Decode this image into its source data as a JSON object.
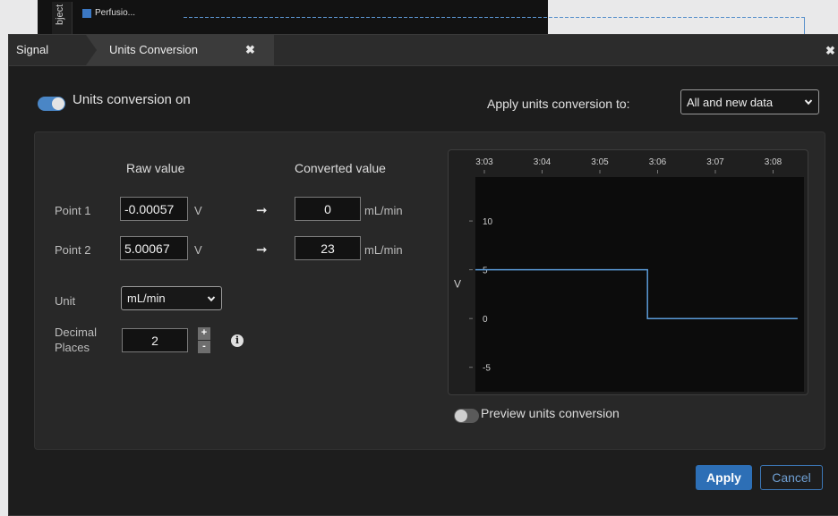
{
  "background": {
    "vertical_tab": "bject",
    "channel_name": "Perfusio...",
    "channel_color": "#3b78c4"
  },
  "tabs": {
    "signal": "Signal",
    "active": "Units Conversion",
    "close_glyph": "✖",
    "dialog_close_glyph": "✖"
  },
  "toggle_main": {
    "label": "Units conversion on",
    "on": true
  },
  "apply_to": {
    "label": "Apply units conversion to:",
    "selected": "All and new data"
  },
  "headers": {
    "raw": "Raw value",
    "converted": "Converted value"
  },
  "points": [
    {
      "label": "Point 1",
      "raw": "-0.00057",
      "raw_unit": "V",
      "converted": "0",
      "converted_unit": "mL/min"
    },
    {
      "label": "Point 2",
      "raw": "5.00067",
      "raw_unit": "V",
      "converted": "23",
      "converted_unit": "mL/min"
    }
  ],
  "arrow_glyph": "➞",
  "unit": {
    "label": "Unit",
    "selected": "mL/min"
  },
  "decimal": {
    "label_line1": "Decimal",
    "label_line2": "Places",
    "value": "2",
    "plus": "+",
    "minus": "-",
    "info_glyph": "i"
  },
  "preview": {
    "label": "Preview units conversion",
    "on": false
  },
  "buttons": {
    "apply": "Apply",
    "cancel": "Cancel"
  },
  "colors": {
    "accent": "#2d6fb6",
    "trace": "#5b9bd8",
    "toggle_on": "#4a86c6"
  },
  "chart_data": {
    "type": "line",
    "x_ticks": [
      "3:03",
      "3:04",
      "3:05",
      "3:06",
      "3:07",
      "3:08"
    ],
    "y_ticks": [
      "10",
      "5",
      "0",
      "-5"
    ],
    "ylabel": "V",
    "ylim": [
      -7.5,
      14.5
    ],
    "series": [
      {
        "x": [
          0,
          2.98,
          2.98,
          5.58
        ],
        "values": [
          5.0,
          5.0,
          0.0,
          0.0
        ]
      }
    ]
  }
}
